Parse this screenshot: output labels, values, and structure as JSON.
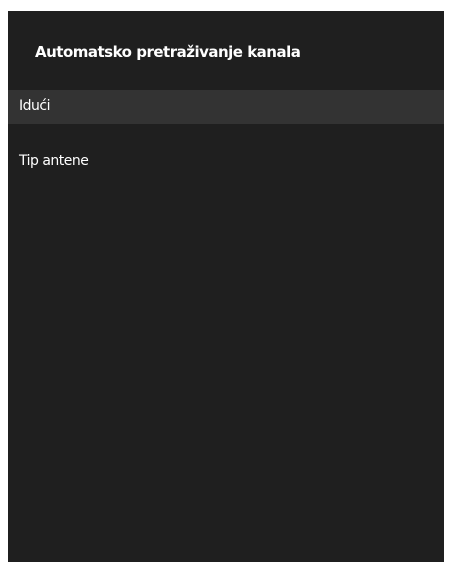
{
  "panel": {
    "title": "Automatsko pretraživanje kanala",
    "background_color": "#1f1f1f",
    "selected_item_color": "#333333"
  },
  "menu": {
    "items": [
      {
        "label": "Idući",
        "selected": true
      },
      {
        "label": "Tip antene",
        "selected": false
      }
    ]
  }
}
